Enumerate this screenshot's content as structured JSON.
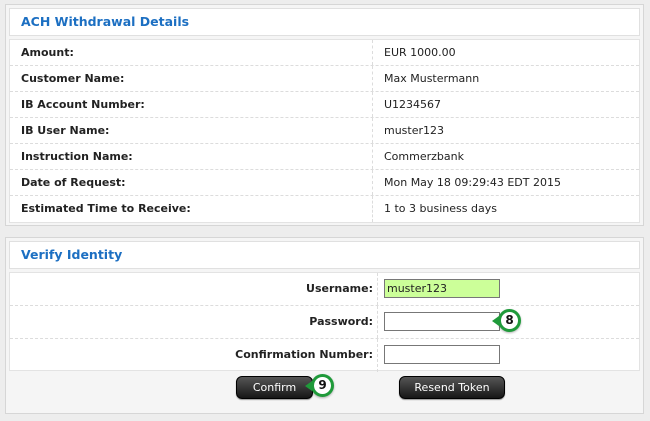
{
  "details": {
    "title": "ACH Withdrawal Details",
    "rows": [
      {
        "label": "Amount:",
        "value": "EUR 1000.00"
      },
      {
        "label": "Customer Name:",
        "value": "Max Mustermann"
      },
      {
        "label": "IB Account Number:",
        "value": "U1234567"
      },
      {
        "label": "IB User Name:",
        "value": "muster123"
      },
      {
        "label": "Instruction Name:",
        "value": "Commerzbank"
      },
      {
        "label": "Date of Request:",
        "value": "Mon May 18 09:29:43 EDT 2015"
      },
      {
        "label": "Estimated Time to Receive:",
        "value": "1 to 3 business days"
      }
    ]
  },
  "verify": {
    "title": "Verify Identity",
    "username_label": "Username:",
    "username_value": "muster123",
    "password_label": "Password:",
    "password_value": "",
    "confirmation_label": "Confirmation Number:",
    "confirmation_value": "",
    "confirm_button": "Confirm",
    "resend_button": "Resend Token"
  },
  "callouts": {
    "password_step": "8",
    "confirm_step": "9"
  },
  "colors": {
    "accent": "#1c6fc2",
    "filled_field": "#ccff99",
    "callout": "#1f9a3a"
  }
}
